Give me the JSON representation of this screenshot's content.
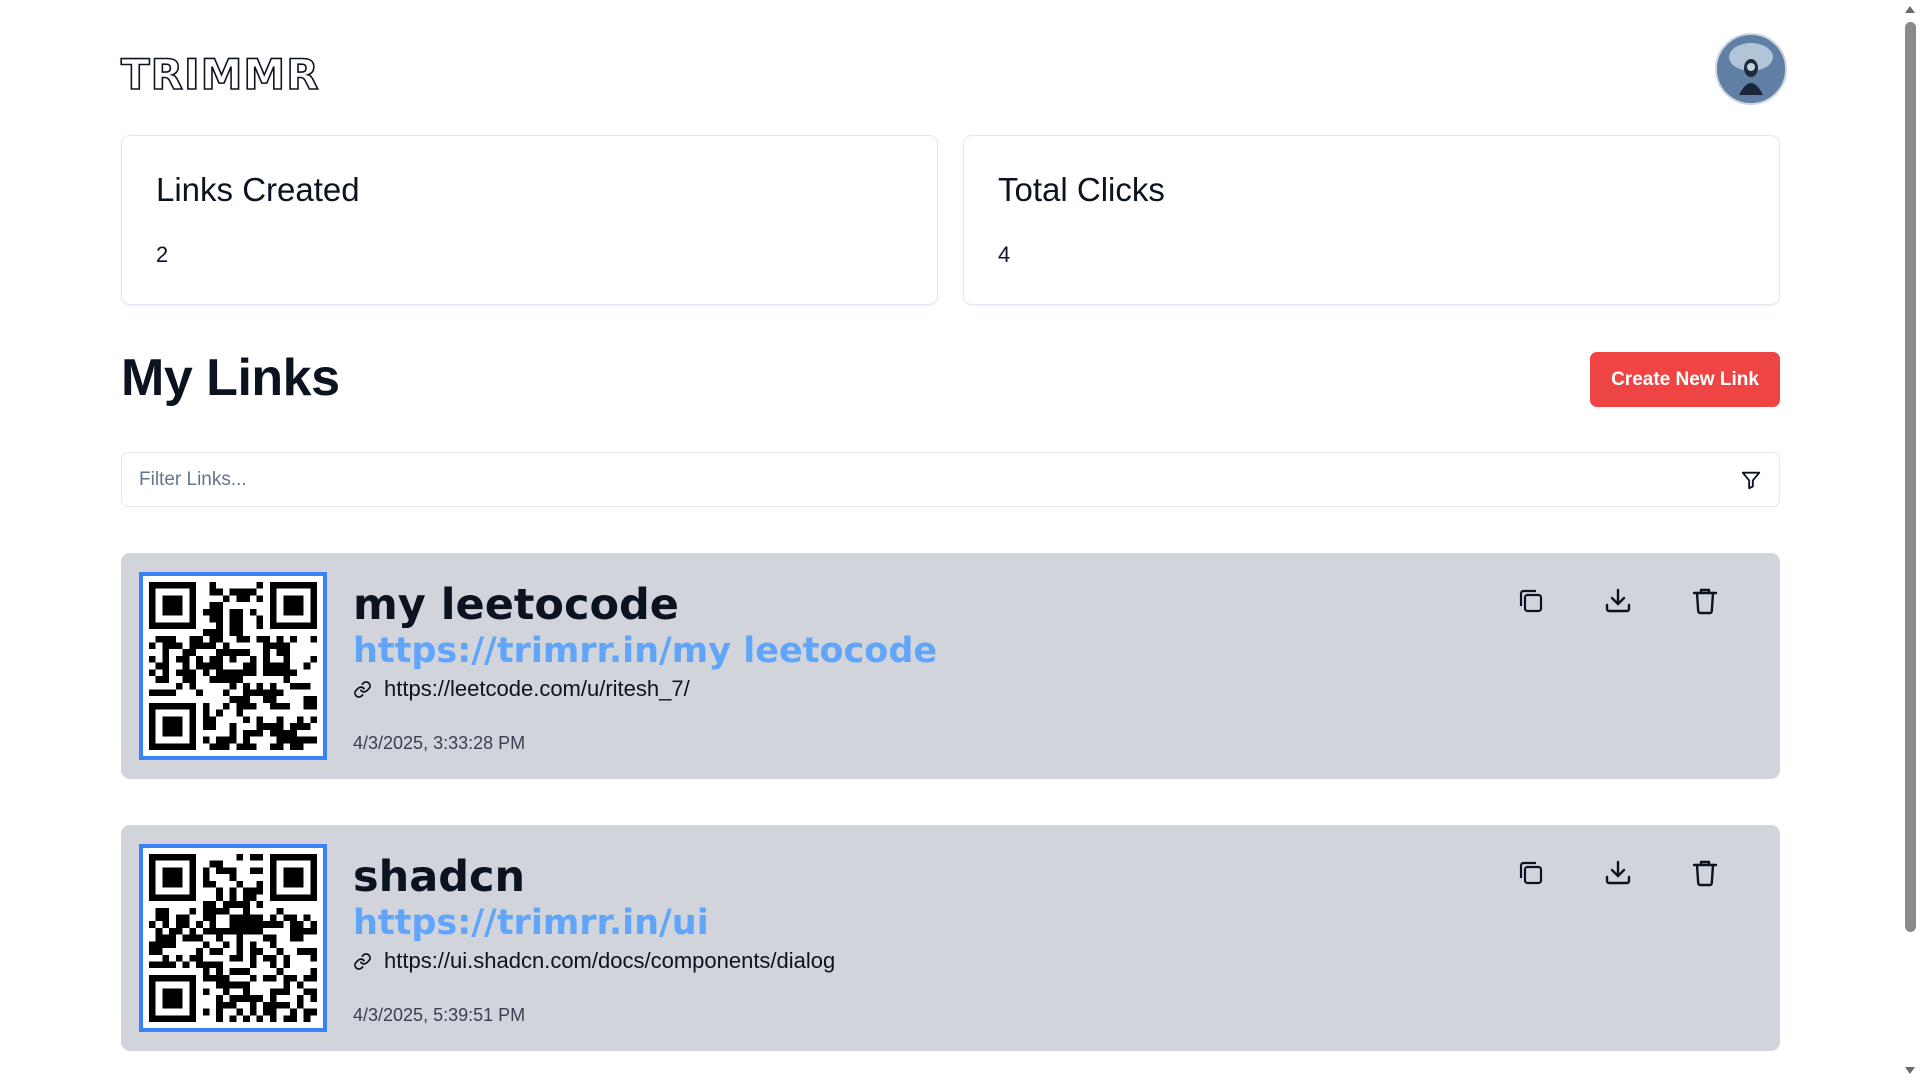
{
  "app": {
    "logo": "TRIMMR"
  },
  "header": {
    "avatar_icon": "user-avatar"
  },
  "stats": [
    {
      "title": "Links Created",
      "value": "2"
    },
    {
      "title": "Total Clicks",
      "value": "4"
    }
  ],
  "links_section": {
    "title": "My Links",
    "create_label": "Create New Link",
    "filter_placeholder": "Filter Links...",
    "filter_value": ""
  },
  "links": [
    {
      "title": "my leetocode",
      "short_url": "https://trimrr.in/my leetocode",
      "long_url": "https://leetcode.com/u/ritesh_7/",
      "date": "4/3/2025, 3:33:28 PM"
    },
    {
      "title": "shadcn",
      "short_url": "https://trimrr.in/ui",
      "long_url": "https://ui.shadcn.com/docs/components/dialog",
      "date": "4/3/2025, 5:39:51 PM"
    }
  ],
  "icons": {
    "filter": "filter-icon",
    "copy": "copy-icon",
    "download": "download-icon",
    "delete": "trash-icon",
    "link": "link-icon"
  },
  "colors": {
    "accent": "#ef4444",
    "short_url": "#60a5fa",
    "qr_border": "#3b82f6",
    "card_bg": "#d1d5db"
  }
}
